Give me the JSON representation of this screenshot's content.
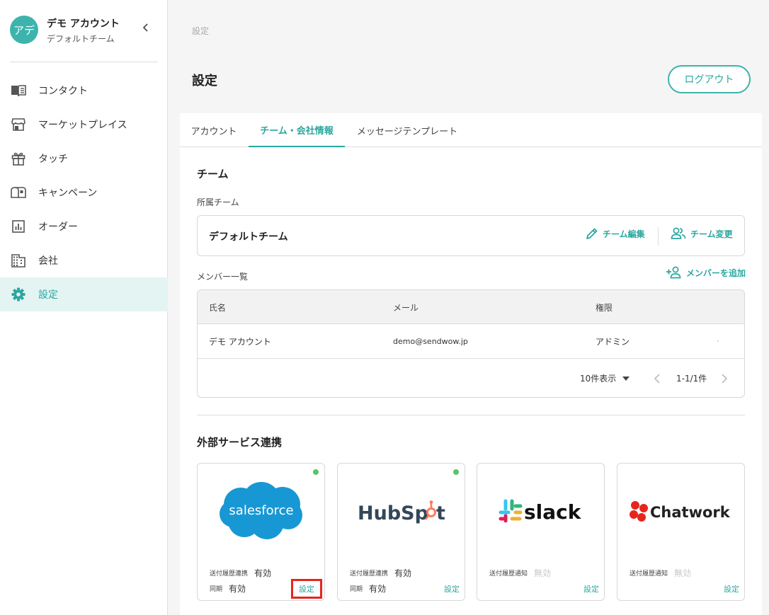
{
  "sidebar": {
    "avatar_text": "アデ",
    "account_name": "デモ アカウント",
    "team_name": "デフォルトチーム",
    "items": [
      {
        "label": "コンタクト",
        "icon": "contacts-book-icon"
      },
      {
        "label": "マーケットプレイス",
        "icon": "store-icon"
      },
      {
        "label": "タッチ",
        "icon": "gift-icon"
      },
      {
        "label": "キャンペーン",
        "icon": "mailbox-icon"
      },
      {
        "label": "オーダー",
        "icon": "bar-chart-icon"
      },
      {
        "label": "会社",
        "icon": "building-icon"
      },
      {
        "label": "設定",
        "icon": "gear-icon"
      }
    ],
    "active_index": 6
  },
  "header": {
    "breadcrumb": "設定",
    "title": "設定",
    "logout_label": "ログアウト"
  },
  "tabs": [
    {
      "label": "アカウント"
    },
    {
      "label": "チーム・会社情報"
    },
    {
      "label": "メッセージテンプレート"
    }
  ],
  "team": {
    "section_title": "チーム",
    "belong_label": "所属チーム",
    "name": "デフォルトチーム",
    "edit_label": "チーム編集",
    "change_label": "チーム変更"
  },
  "members": {
    "label": "メンバー一覧",
    "add_label": "メンバーを追加",
    "columns": [
      "氏名",
      "メール",
      "権限"
    ],
    "rows": [
      {
        "name": "デモ アカウント",
        "email": "demo@sendwow.jp",
        "role": "アドミン"
      }
    ],
    "per_page": "10件表示",
    "range": "1-1/1件"
  },
  "integrations": {
    "title": "外部サービス連携",
    "cards": [
      {
        "service": "salesforce",
        "connected": true,
        "row1_key": "送付履歴連携",
        "row1_value": "有効",
        "row2_key": "同期",
        "row2_value": "有効",
        "settings_label": "設定"
      },
      {
        "service": "HubSpot",
        "connected": true,
        "row1_key": "送付履歴連携",
        "row1_value": "有効",
        "row2_key": "同期",
        "row2_value": "有効",
        "settings_label": "設定"
      },
      {
        "service": "slack",
        "connected": false,
        "row1_key": "送付履歴通知",
        "row1_value": "無効",
        "settings_label": "設定"
      },
      {
        "service": "Chatwork",
        "connected": false,
        "row1_key": "送付履歴通知",
        "row1_value": "無効",
        "settings_label": "設定"
      }
    ]
  },
  "colors": {
    "accent": "#3cb4ac",
    "highlight": "#e5261f",
    "connected_dot": "#5ac466"
  }
}
